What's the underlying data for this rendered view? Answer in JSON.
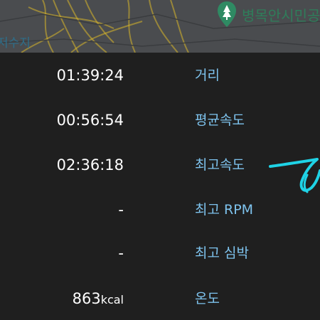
{
  "map": {
    "label_reservoir": "저수지",
    "label_park": "병목안시민공",
    "pin_icon": "park-pin-icon",
    "colors": {
      "background": "#4a4c4f",
      "roads": "#d8b72a",
      "pin": "#2f8a63"
    }
  },
  "stats": [
    {
      "value": "01:39:24",
      "unit": "",
      "label": "거리"
    },
    {
      "value": "00:56:54",
      "unit": "",
      "label": "평균속도"
    },
    {
      "value": "02:36:18",
      "unit": "",
      "label": "최고속도"
    },
    {
      "value": "-",
      "unit": "",
      "label": "최고 RPM"
    },
    {
      "value": "-",
      "unit": "",
      "label": "최고 심박"
    },
    {
      "value": "863",
      "unit": "kcal",
      "label": "온도"
    }
  ],
  "colors": {
    "background": "#1f1f1f",
    "value_text": "#ffffff",
    "label_text": "#7ec3ee",
    "annotation": "#1fd3e6"
  }
}
